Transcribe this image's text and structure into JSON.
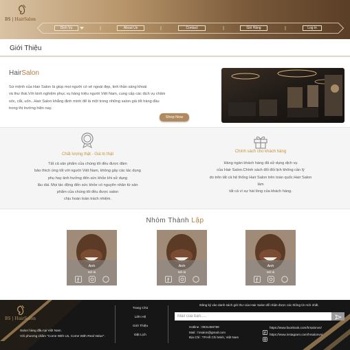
{
  "header": {
    "logo_text_prefix": "BS | ",
    "logo_text_brand": "HairSalon",
    "nav": [
      {
        "label": "Dịch Vụ",
        "name": "nav-dich-vu"
      },
      {
        "label": "About Us",
        "name": "nav-about-us"
      },
      {
        "label": "Contact",
        "name": "nav-contact"
      },
      {
        "label": "Giỏ Hàng",
        "name": "nav-gio-hang"
      },
      {
        "label": "Log in",
        "name": "nav-log-in"
      }
    ]
  },
  "page_title": "Giới Thiệu",
  "intro": {
    "title_part1": "Hair",
    "title_part2": "Salon",
    "lines": [
      "Sứ mệnh của Hair Salon là giúp mọi người có vẻ ngoài đẹp, tinh thần sảng khoái",
      "và thư thái.Với kinh nghiệm phục vụ hàng triệu người Việt Nam, cung cấp các dịch vụ chăm",
      "sóc, cắt, uốn...Hair Salon khẳng định mình để là một trong những salon giá tốt hàng đầu",
      "trong thị trường hiện nay."
    ],
    "button_label": "Shop Now"
  },
  "policy": {
    "quality": {
      "title": "Chất lượng thật - Giá trị thật",
      "lines": [
        "Tất cả sản phẩm của chúng tôi đều được đảm",
        "bảo thích ứng tốt với người Việt Nam, không gây các tác dụng",
        "phụ hay ảnh hưởng đến sức khỏe khi sử dụng",
        "lâu dài. Mọi tác động đến sức khỏe có nguyên nhân từ sản",
        "phẩm của chúng tôi đều được salon",
        "chịu hoàn toàn trách nhiệm."
      ]
    },
    "customer": {
      "title": "Chính sách cho khách hàng",
      "lines": [
        "Hàng ngàn khách hàng đã sử dụng dịch vụ",
        "của Hair Salon.Chính sách đổi đối lịch không cần lý",
        "do trên tất cả hệ thống Hair Salon trên toàn quốc.Hair Salon",
        "làm",
        "tất cả vì sự hài lòng của khách hàng."
      ]
    }
  },
  "team": {
    "title_part1": "Nhóm  Thành ",
    "title_part2": "Lập",
    "members": [
      {
        "name": "Anh",
        "role": "Mô tả"
      },
      {
        "name": "Anh",
        "role": "Mô tả"
      },
      {
        "name": "Anh",
        "role": "Mô tả"
      }
    ]
  },
  "footer": {
    "logo_text_prefix": "BS | ",
    "logo_text_brand": "HairSalon",
    "desc_lines": [
      "Salon hàng đầu tại Việt Nam.",
      "Với phương châm \"Come With Us, Come With Real Value\"."
    ],
    "links": [
      "Trang Chủ",
      "Liên Hệ",
      "Giới Thiệu",
      "Đặt Lịch"
    ],
    "newsletter_note": "Đăng ký vào danh sách gửi thư của Hair Salon để nhận được các thông tin mới nhất.",
    "email_placeholder": "Mail của bạn.....",
    "contact_lines": [
      "Hotline : 0931456789",
      "Mail : hrsalon@gmail.com",
      "Địa Chỉ : TP.Hồ Chí Minh, Việt Nam"
    ],
    "facebook": "https://www.facebook.com/hrsalonvn/",
    "instagram": "https://www.instagram.com/hrsalonvn/"
  },
  "colors": {
    "accent_gold": "#b07e3e",
    "footer_bg": "#161616",
    "policy_bg": "#f5f5f5"
  }
}
